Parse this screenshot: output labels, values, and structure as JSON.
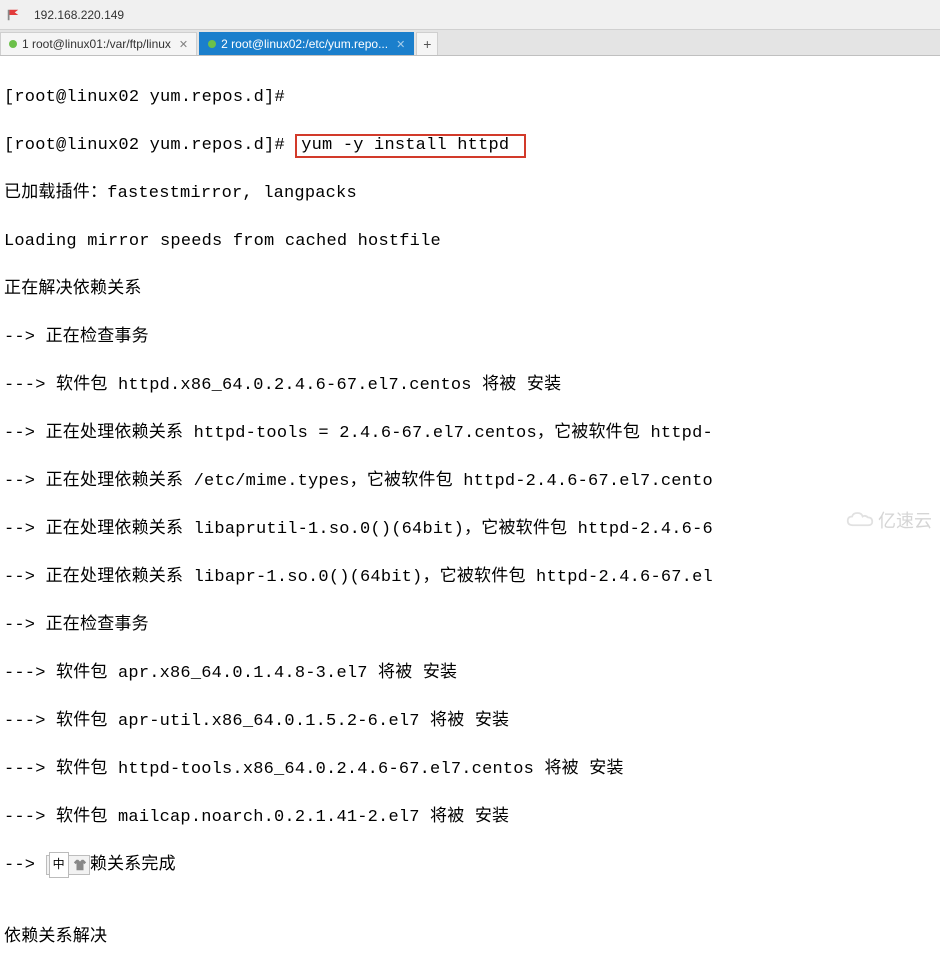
{
  "titlebar": {
    "ip": "192.168.220.149"
  },
  "tabs": {
    "t1": {
      "label": "1 root@linux01:/var/ftp/linux"
    },
    "t2": {
      "label": "2 root@linux02:/etc/yum.repo..."
    }
  },
  "term": {
    "l1_prompt": "[root@linux02 yum.repos.d]#",
    "l2_prompt": "[root@linux02 yum.repos.d]# ",
    "l2_cmd": "yum -y install httpd ",
    "l3": "已加载插件：fastestmirror, langpacks",
    "l4": "Loading mirror speeds from cached hostfile",
    "l5": "正在解决依赖关系",
    "l6": "--> 正在检查事务",
    "l7": "---> 软件包 httpd.x86_64.0.2.4.6-67.el7.centos 将被 安装",
    "l8": "--> 正在处理依赖关系 httpd-tools = 2.4.6-67.el7.centos，它被软件包 httpd-",
    "l9": "--> 正在处理依赖关系 /etc/mime.types，它被软件包 httpd-2.4.6-67.el7.cento",
    "l10": "--> 正在处理依赖关系 libaprutil-1.so.0()(64bit)，它被软件包 httpd-2.4.6-6",
    "l11": "--> 正在处理依赖关系 libapr-1.so.0()(64bit)，它被软件包 httpd-2.4.6-67.el",
    "l12": "--> 正在检查事务",
    "l13": "---> 软件包 apr.x86_64.0.1.4.8-3.el7 将被 安装",
    "l14": "---> 软件包 apr-util.x86_64.0.1.5.2-6.el7 将被 安装",
    "l15": "---> 软件包 httpd-tools.x86_64.0.2.4.6-67.el7.centos 将被 安装",
    "l16": "---> 软件包 mailcap.noarch.0.2.1.41-2.el7 将被 安装",
    "l17a": "--> ",
    "l17b": "赖关系完成",
    "l18": "",
    "l19": "依赖关系解决"
  },
  "ime": {
    "cn": "中"
  },
  "watermark": {
    "text": "亿速云"
  }
}
